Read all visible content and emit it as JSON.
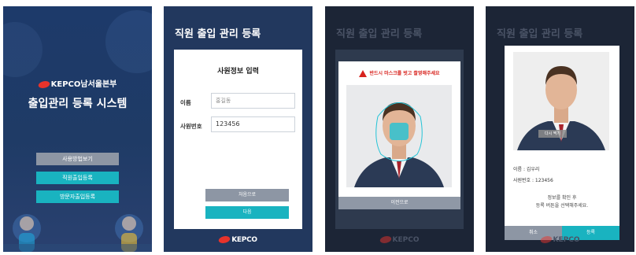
{
  "screen1": {
    "brand": "KEPCO",
    "brand_suffix": "남서울본부",
    "title": "출입관리 등록 시스템",
    "buttons": [
      "사용방법보기",
      "직원출입등록",
      "방문자출입등록"
    ]
  },
  "screen2": {
    "header": "직원 출입 관리 등록",
    "panel_title": "사원정보 입력",
    "name_label": "이름",
    "name_placeholder": "홍길동",
    "id_label": "사원번호",
    "id_value": "123456",
    "btn_prev": "처음으로",
    "btn_next": "다음",
    "footer": "KEPCO"
  },
  "screen3": {
    "header": "직원 출입 관리 등록",
    "warning": "반드시 마스크를 벗고 촬영해주세요",
    "bottom_button": "이전으로",
    "footer": "KEPCO"
  },
  "screen4": {
    "header": "직원 출입 관리 등록",
    "retake": "다시 찍기",
    "name_line": "이름 : 김우리",
    "id_line": "사원번호 : 123456",
    "confirm_1": "정보를 확인 후",
    "confirm_2": "등록 버튼을 선택해주세요.",
    "btn_cancel": "취소",
    "btn_register": "등록",
    "footer": "KEPCO"
  },
  "colors": {
    "navy": "#22385e",
    "teal": "#19b3c0",
    "gray_button": "#8d96a4",
    "warning_red": "#d8231e",
    "logo_red": "#e8332b"
  }
}
